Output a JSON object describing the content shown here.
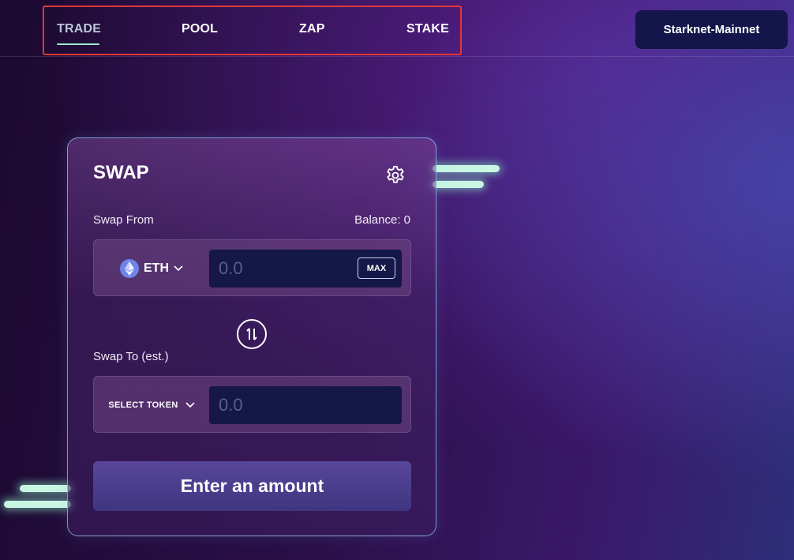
{
  "nav": {
    "items": [
      {
        "label": "TRADE",
        "active": true
      },
      {
        "label": "POOL",
        "active": false
      },
      {
        "label": "ZAP",
        "active": false
      },
      {
        "label": "STAKE",
        "active": false
      }
    ],
    "network_label": "Starknet-Mainnet"
  },
  "swap": {
    "title": "SWAP",
    "from_label": "Swap From",
    "balance_text": "Balance: 0",
    "from_token": "ETH",
    "from_amount_placeholder": "0.0",
    "max_label": "MAX",
    "to_label": "Swap To (est.)",
    "to_token_placeholder": "SELECT TOKEN",
    "to_amount_placeholder": "0.0",
    "submit_label": "Enter an amount"
  },
  "icons": {
    "settings": "gear-icon",
    "switch": "swap-arrows-icon",
    "eth": "ethereum-icon",
    "dropdown": "chevron-down-icon"
  },
  "colors": {
    "accent_underline": "#9fe8d0",
    "network_button_bg": "#14154a",
    "input_bg": "#151748",
    "highlight_box": "#e0383a"
  }
}
